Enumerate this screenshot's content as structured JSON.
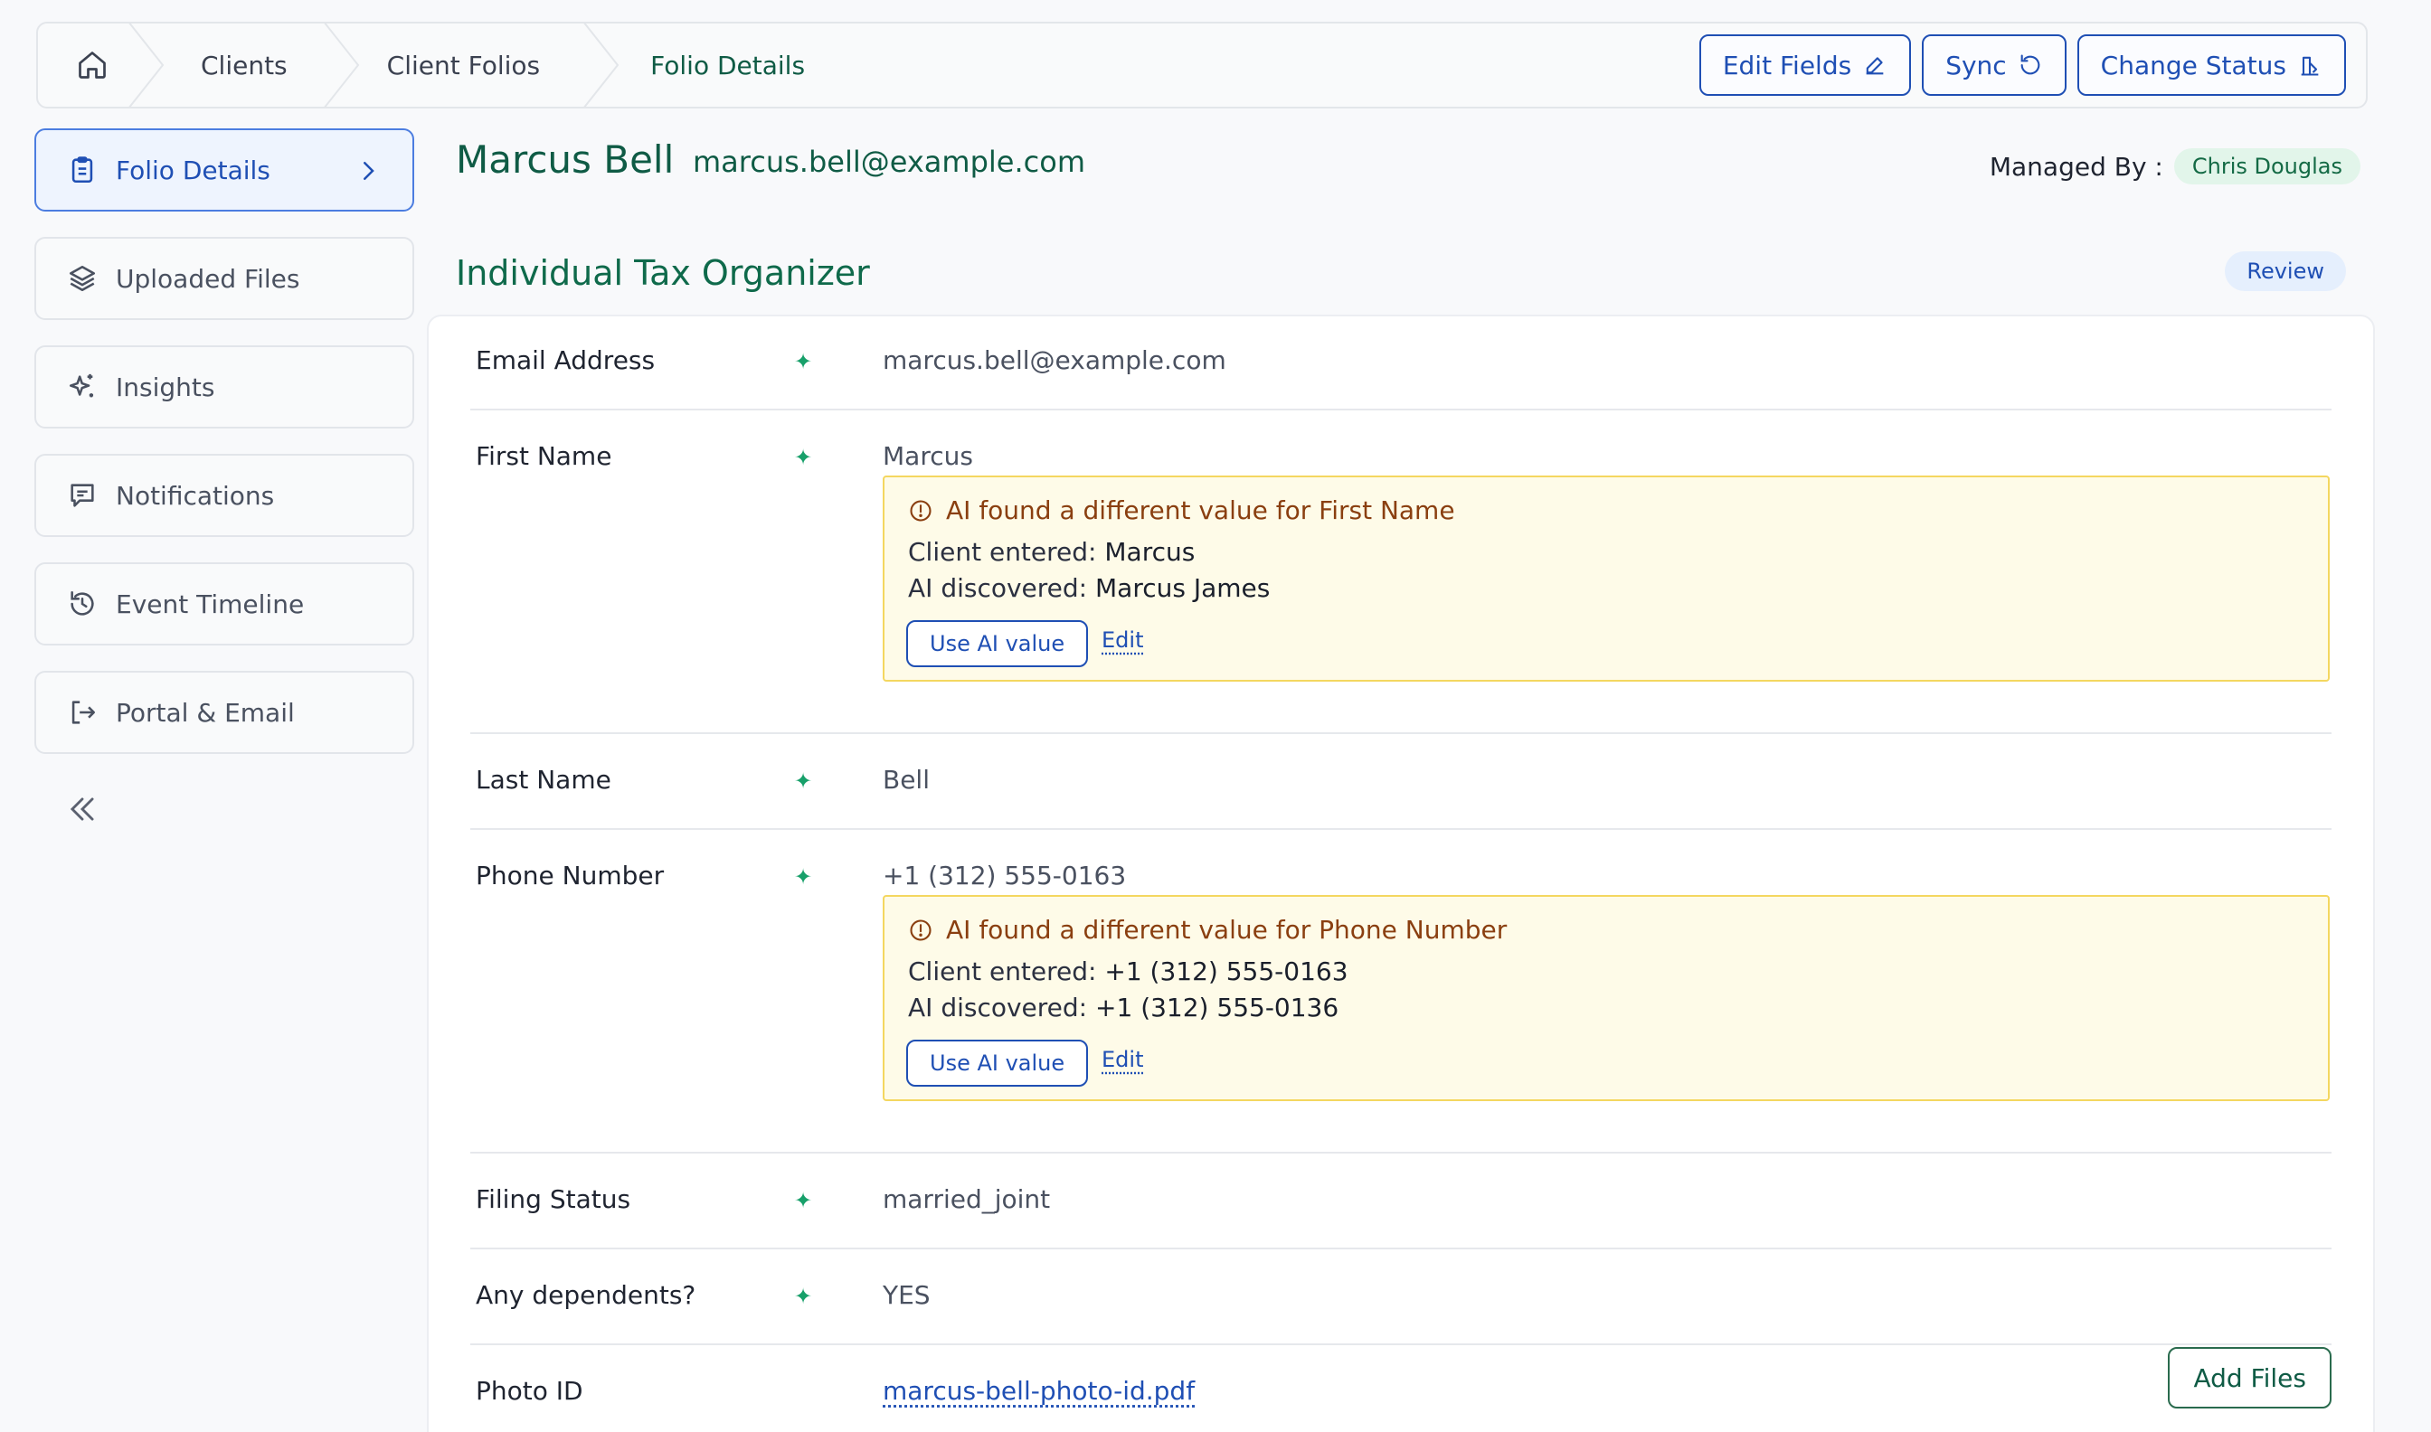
{
  "breadcrumb": {
    "items": [
      "Clients",
      "Client Folios",
      "Folio Details"
    ]
  },
  "toolbar": {
    "edit_fields": "Edit Fields",
    "sync": "Sync",
    "change_status": "Change Status"
  },
  "sidebar": {
    "items": [
      {
        "label": "Folio Details",
        "icon": "clipboard-icon",
        "active": true
      },
      {
        "label": "Uploaded Files",
        "icon": "layers-icon"
      },
      {
        "label": "Insights",
        "icon": "sparkles-icon"
      },
      {
        "label": "Notifications",
        "icon": "message-icon"
      },
      {
        "label": "Event Timeline",
        "icon": "history-icon"
      },
      {
        "label": "Portal & Email",
        "icon": "logout-icon"
      }
    ]
  },
  "client": {
    "name": "Marcus Bell",
    "email": "marcus.bell@example.com",
    "managed_by_label": "Managed By :",
    "managed_by": "Chris Douglas"
  },
  "section": {
    "title": "Individual Tax Organizer",
    "status": "Review"
  },
  "fields": {
    "email": {
      "label": "Email Address",
      "value": "marcus.bell@example.com"
    },
    "first_name": {
      "label": "First Name",
      "value": "Marcus",
      "ai": {
        "heading": "AI found a different value for First Name",
        "client_label": "Client entered:",
        "client_value": "Marcus",
        "ai_label": "AI discovered:",
        "ai_value": "Marcus James",
        "use_label": "Use AI value",
        "edit_label": "Edit"
      }
    },
    "last_name": {
      "label": "Last Name",
      "value": "Bell"
    },
    "phone": {
      "label": "Phone Number",
      "value": "+1 (312) 555-0163",
      "ai": {
        "heading": "AI found a different value for Phone Number",
        "client_label": "Client entered:",
        "client_value": "+1 (312) 555-0163",
        "ai_label": "AI discovered:",
        "ai_value": "+1 (312) 555-0136",
        "use_label": "Use AI value",
        "edit_label": "Edit"
      }
    },
    "filing_status": {
      "label": "Filing Status",
      "value": "married_joint"
    },
    "dependents": {
      "label": "Any dependents?",
      "value": "YES"
    },
    "photo_id": {
      "label": "Photo ID",
      "value": "marcus-bell-photo-id.pdf",
      "add_label": "Add Files"
    }
  },
  "ai_marker": "✦",
  "colors": {
    "primary_blue": "#1f4fb4",
    "brand_green": "#0f5b45",
    "warning_bg": "#fefbe8",
    "warning_border": "#f4d760"
  }
}
